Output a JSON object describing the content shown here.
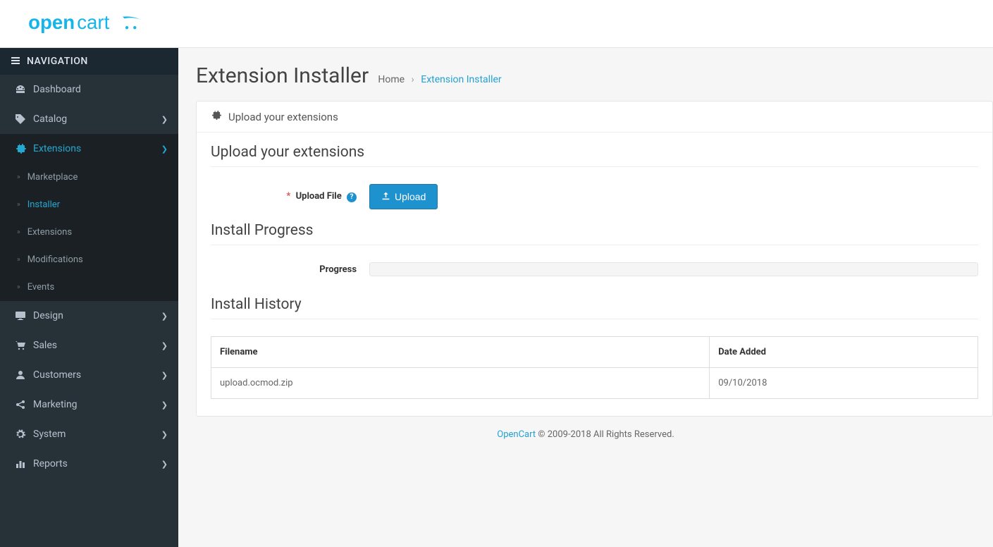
{
  "logo": {
    "brand1": "open",
    "brand2": "cart"
  },
  "nav": {
    "header": "NAVIGATION",
    "items": [
      {
        "label": "Dashboard",
        "icon": "dashboard",
        "expand": false
      },
      {
        "label": "Catalog",
        "icon": "tag",
        "expand": true
      },
      {
        "label": "Extensions",
        "icon": "puzzle",
        "expand": true,
        "active": true
      },
      {
        "label": "Design",
        "icon": "desktop",
        "expand": true
      },
      {
        "label": "Sales",
        "icon": "cart",
        "expand": true
      },
      {
        "label": "Customers",
        "icon": "user",
        "expand": true
      },
      {
        "label": "Marketing",
        "icon": "share",
        "expand": true
      },
      {
        "label": "System",
        "icon": "cog",
        "expand": true
      },
      {
        "label": "Reports",
        "icon": "bar-chart",
        "expand": true
      }
    ],
    "sub": [
      {
        "label": "Marketplace"
      },
      {
        "label": "Installer",
        "active": true
      },
      {
        "label": "Extensions"
      },
      {
        "label": "Modifications"
      },
      {
        "label": "Events"
      }
    ]
  },
  "page": {
    "title": "Extension Installer",
    "breadcrumb_home": "Home",
    "breadcrumb_sep": "›",
    "breadcrumb_current": "Extension Installer"
  },
  "panel": {
    "heading": "Upload your extensions",
    "section1_title": "Upload your extensions",
    "upload_label": "Upload File",
    "upload_button": "Upload",
    "section2_title": "Install Progress",
    "progress_label": "Progress",
    "section3_title": "Install History",
    "table": {
      "col_filename": "Filename",
      "col_date": "Date Added",
      "rows": [
        {
          "filename": "upload.ocmod.zip",
          "date": "09/10/2018"
        }
      ]
    }
  },
  "footer": {
    "link": "OpenCart",
    "text": " © 2009-2018 All Rights Reserved."
  }
}
